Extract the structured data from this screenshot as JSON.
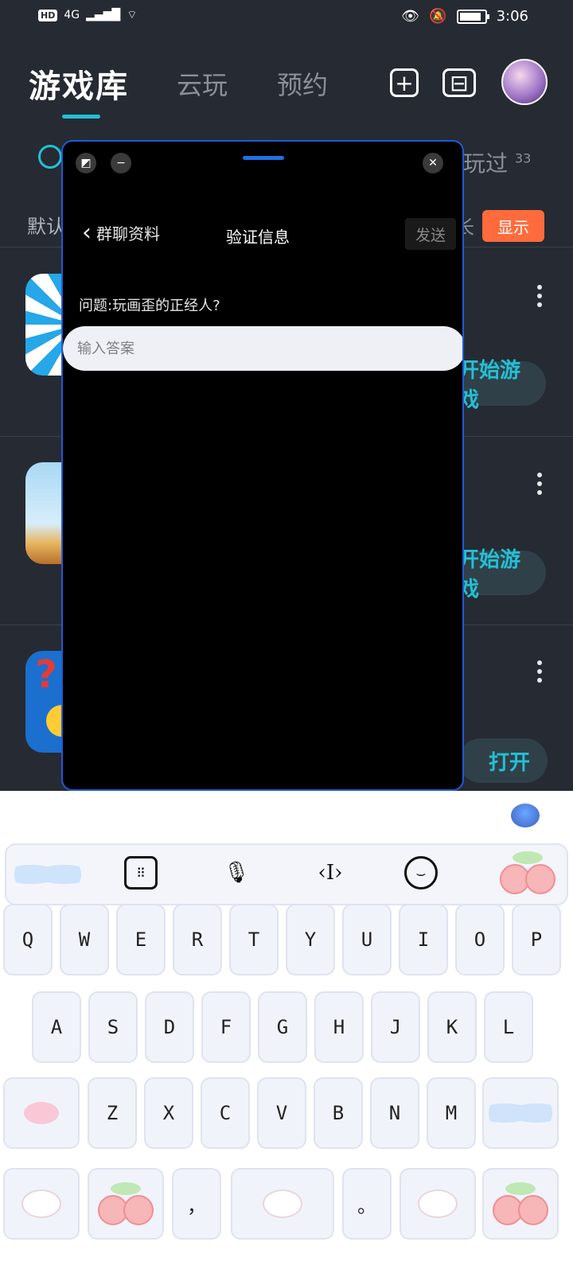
{
  "status": {
    "hd": "HD",
    "network": "4G",
    "signal": "▂▄▆█",
    "time": "3:06"
  },
  "header": {
    "title": "游戏库",
    "tabs": [
      "云玩",
      "预约"
    ],
    "add_icon": "plus-square-icon",
    "toolbox_icon": "toolbox-icon"
  },
  "subbar": {
    "played_label": "玩过",
    "played_count": "33",
    "sort_label": "默认",
    "sort_right": "长",
    "show_button": "显示"
  },
  "games": [
    {
      "button": "开始游戏"
    },
    {
      "button": "开始游戏"
    },
    {
      "button": "打开"
    }
  ],
  "popup": {
    "back_label": "群聊资料",
    "title": "验证信息",
    "send_label": "发送",
    "question": "问题:玩画歪的正经人?",
    "answer_placeholder": "输入答案"
  },
  "keyboard": {
    "row1": [
      "Q",
      "W",
      "E",
      "R",
      "T",
      "Y",
      "U",
      "I",
      "O",
      "P"
    ],
    "row2": [
      "A",
      "S",
      "D",
      "F",
      "G",
      "H",
      "J",
      "K",
      "L"
    ],
    "row3": [
      "Z",
      "X",
      "C",
      "V",
      "B",
      "N",
      "M"
    ],
    "comma": "，",
    "period": "。",
    "toolbar_icons": [
      "keyboard-icon",
      "microphone-icon",
      "text-cursor-icon",
      "emoji-icon"
    ]
  },
  "colors": {
    "background": "#262a33",
    "accent": "#23c0d5",
    "show_button": "#ff6b3d",
    "popup_border": "#1f5ad6"
  }
}
